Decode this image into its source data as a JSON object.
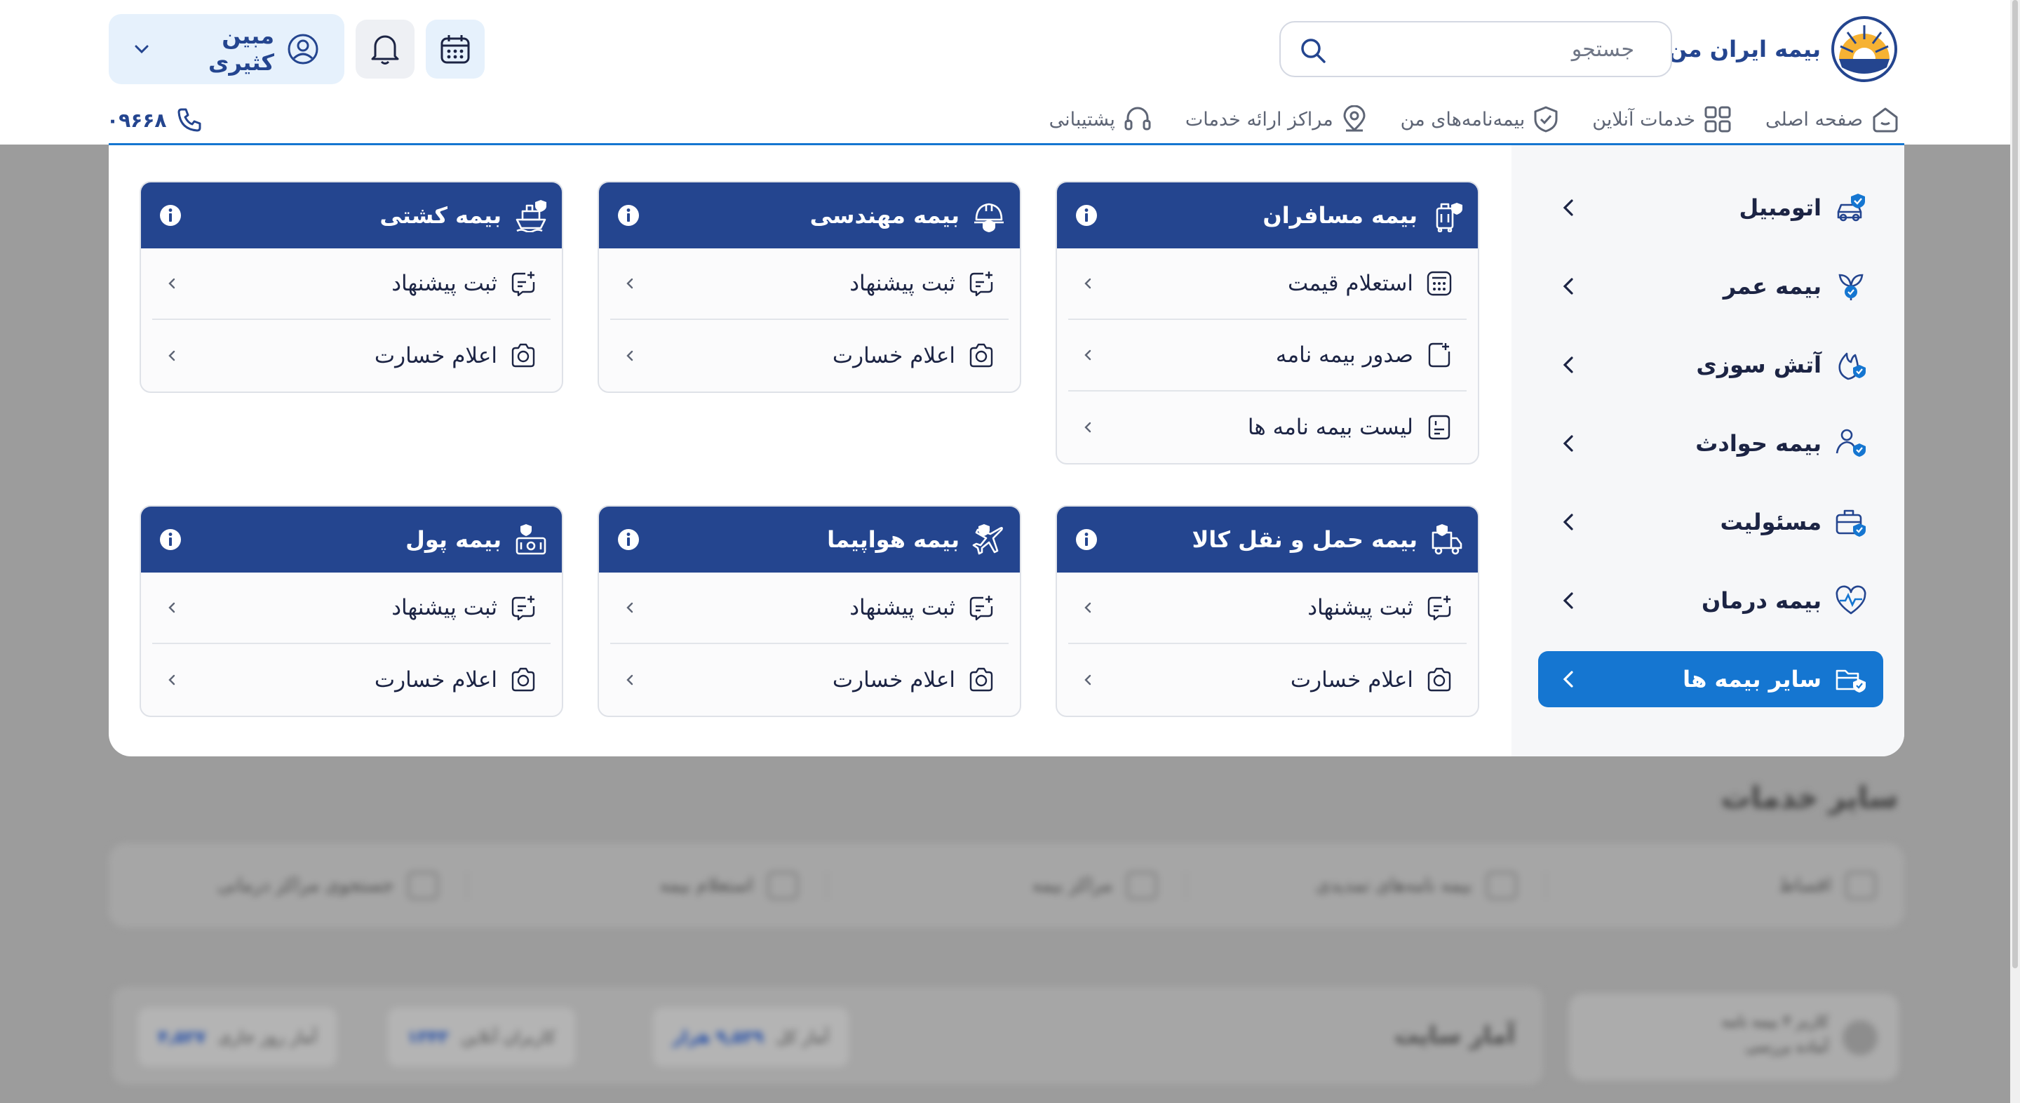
{
  "header": {
    "logo_text": "بیمه ایران من",
    "search_placeholder": "جستجو",
    "user_name": "مبین کثیری",
    "phone": "۰۹۶۶۸"
  },
  "nav": [
    {
      "label": "صفحه اصلی",
      "icon": "home-icon"
    },
    {
      "label": "خدمات آنلاین",
      "icon": "grid-icon"
    },
    {
      "label": "بیمه‌نامه‌های من",
      "icon": "shield-icon"
    },
    {
      "label": "مراکز ارائه خدمات",
      "icon": "location-icon"
    },
    {
      "label": "پشتیبانی",
      "icon": "headset-icon"
    }
  ],
  "categories": [
    {
      "label": "اتومبیل",
      "icon": "car-shield-icon"
    },
    {
      "label": "بیمه عمر",
      "icon": "plant-icon"
    },
    {
      "label": "آتش سوزی",
      "icon": "flame-icon"
    },
    {
      "label": "بیمه حوادث",
      "icon": "person-shield-icon"
    },
    {
      "label": "مسئولیت",
      "icon": "briefcase-icon"
    },
    {
      "label": "بیمه درمان",
      "icon": "heart-pulse-icon"
    },
    {
      "label": "سایر بیمه ها",
      "icon": "folder-shield-icon",
      "active": true
    }
  ],
  "cards": [
    {
      "title": "بیمه مسافران",
      "icon": "luggage-icon",
      "rows": [
        {
          "label": "استعلام قیمت",
          "icon": "calculator-icon"
        },
        {
          "label": "صدور بیمه نامه",
          "icon": "doc-plus-icon"
        },
        {
          "label": "لیست بیمه نامه ها",
          "icon": "doc-list-icon"
        }
      ]
    },
    {
      "title": "بیمه مهندسی",
      "icon": "helmet-icon",
      "rows": [
        {
          "label": "ثبت پیشنهاد",
          "icon": "chat-plus-icon"
        },
        {
          "label": "اعلام خسارت",
          "icon": "camera-icon"
        }
      ]
    },
    {
      "title": "بیمه کشتی",
      "icon": "ship-icon",
      "rows": [
        {
          "label": "ثبت پیشنهاد",
          "icon": "chat-plus-icon"
        },
        {
          "label": "اعلام خسارت",
          "icon": "camera-icon"
        }
      ]
    },
    {
      "title": "بیمه حمل و نقل کالا",
      "icon": "truck-icon",
      "rows": [
        {
          "label": "ثبت پیشنهاد",
          "icon": "chat-plus-icon"
        },
        {
          "label": "اعلام خسارت",
          "icon": "camera-icon"
        }
      ]
    },
    {
      "title": "بیمه هواپیما",
      "icon": "airplane-icon",
      "rows": [
        {
          "label": "ثبت پیشنهاد",
          "icon": "chat-plus-icon"
        },
        {
          "label": "اعلام خسارت",
          "icon": "camera-icon"
        }
      ]
    },
    {
      "title": "بیمه پول",
      "icon": "money-icon",
      "rows": [
        {
          "label": "ثبت پیشنهاد",
          "icon": "chat-plus-icon"
        },
        {
          "label": "اعلام خسارت",
          "icon": "camera-icon"
        }
      ]
    }
  ],
  "background": {
    "heading": "سایر خدمات",
    "services": [
      "اقساط",
      "بیمه نامه‌های تمدیدی",
      "مراکز بیمه",
      "استعلام بیمه",
      "جستجوی مراکز درمانی"
    ],
    "stats_title": "آمار سایت",
    "stats": [
      {
        "label": "آمار کل",
        "value": "۹,۵۳۹ هزار"
      },
      {
        "label": "کاربران آنلاین",
        "value": "۱۳۴۳"
      },
      {
        "label": "آمار روز جاری",
        "value": "۴,۵۲۷"
      }
    ],
    "notice": [
      "کاربر ۴ بیمه نامه",
      "آماده بررسی"
    ]
  },
  "colors": {
    "primary": "#24458f",
    "accent": "#1576d1",
    "card_border": "#dfe2e8",
    "panel_bg": "#f6f7f9"
  }
}
